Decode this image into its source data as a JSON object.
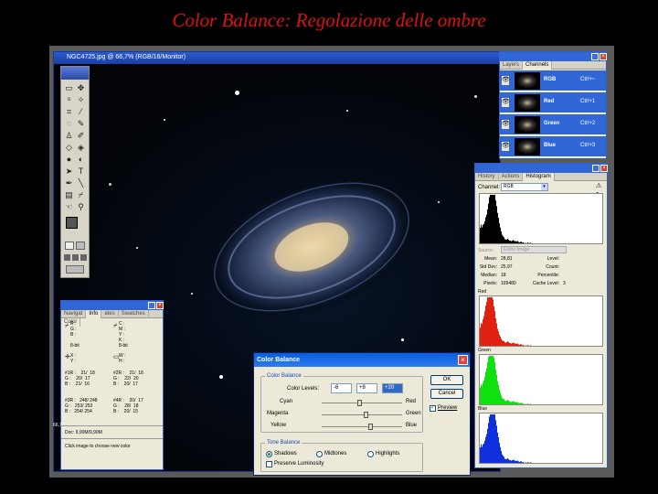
{
  "slide": {
    "title": "Color Balance: Regolazione delle ombre"
  },
  "document": {
    "title": "NGC4725.jpg @ 66,7% (RGB/16/Monitor)"
  },
  "status": {
    "zoom": "66,7",
    "doc": "Doc: 9,90M/9,90M",
    "hint": "Click image to choose new color"
  },
  "channels_palette": {
    "tabs": [
      "Layers",
      "Channels"
    ],
    "active_tab": "Channels",
    "rows": [
      {
        "name": "RGB",
        "shortcut": "Ctrl+~"
      },
      {
        "name": "Red",
        "shortcut": "Ctrl+1"
      },
      {
        "name": "Green",
        "shortcut": "Ctrl+2"
      },
      {
        "name": "Blue",
        "shortcut": "Ctrl+3"
      }
    ]
  },
  "histogram_palette": {
    "tabs": [
      "History",
      "Actions",
      "Histogram"
    ],
    "channel_label": "Channel:",
    "channel_value": "RGB",
    "source_label": "Source:",
    "source_value": "Entire Image",
    "stats_left": [
      {
        "label": "Mean:",
        "value": "28,81"
      },
      {
        "label": "Std Dev:",
        "value": "25,97"
      },
      {
        "label": "Median:",
        "value": "18"
      },
      {
        "label": "Pixels:",
        "value": "109480"
      }
    ],
    "stats_right": [
      {
        "label": "Level:",
        "value": ""
      },
      {
        "label": "Count:",
        "value": ""
      },
      {
        "label": "Percentile:",
        "value": ""
      },
      {
        "label": "Cache Level:",
        "value": "3"
      }
    ],
    "sections": [
      "Red",
      "Green",
      "Blue"
    ],
    "colors": {
      "rgb": "#000000",
      "red": "#e02010",
      "green": "#10e010",
      "blue": "#1030e0"
    }
  },
  "info_palette": {
    "tabs": [
      "Navigat",
      "Info",
      "ates",
      "Swatches",
      "Color"
    ],
    "active_tab": "Info",
    "block1_left": "R :\nG :\nB :\n\n8-bit",
    "block1_right": "C :\nM :\nY :\nK :\n8-bit",
    "block2_left": "X :\nY :",
    "block2_right": "W :\nH :",
    "block3_left": "#1R :    21/  18\nG :    20/  17\nB :    21/  16",
    "block3_right": "#2R :    21/  18\nG :    22/  20\nB :    20/  17",
    "block4_left": "#3R :   248/ 248\nG :   253/ 253\nB :   254/ 254",
    "block4_right": "#4R :    20/  17\nG :    28/  18\nB :    20/  15"
  },
  "color_balance": {
    "title": "Color Balance",
    "group_color": "Color Balance",
    "levels_label": "Color Levels:",
    "levels": [
      "-6",
      "+8",
      "+20"
    ],
    "sliders": [
      {
        "left": "Cyan",
        "right": "Red",
        "value": -6
      },
      {
        "left": "Magenta",
        "right": "Green",
        "value": 8
      },
      {
        "left": "Yellow",
        "right": "Blue",
        "value": 20
      }
    ],
    "group_tone": "Tone Balance",
    "tone_options": [
      "Shadows",
      "Midtones",
      "Highlights"
    ],
    "tone_selected": "Shadows",
    "preserve_label": "Preserve Luminosity",
    "preserve_checked": false,
    "ok_label": "OK",
    "cancel_label": "Cancel",
    "preview_label": "Preview",
    "preview_checked": true
  }
}
